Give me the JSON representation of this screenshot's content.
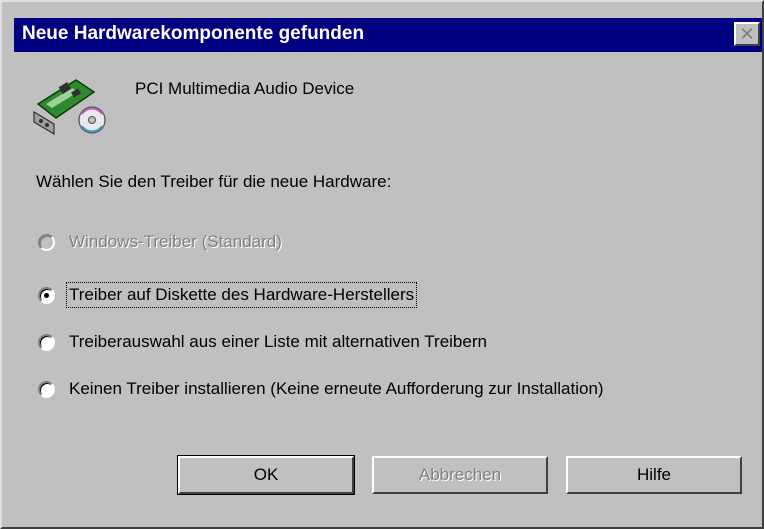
{
  "dialog": {
    "title": "Neue Hardwarekomponente gefunden",
    "close_glyph": "✕"
  },
  "device": {
    "name": "PCI Multimedia Audio Device",
    "icon": "hardware-card-icon"
  },
  "prompt": "Wählen Sie den Treiber für die neue Hardware:",
  "options": [
    {
      "label": "Windows-Treiber (Standard)",
      "checked": false,
      "disabled": true
    },
    {
      "label": "Treiber auf Diskette des Hardware-Herstellers",
      "checked": true,
      "disabled": false
    },
    {
      "label": "Treiberauswahl aus einer Liste mit alternativen Treibern",
      "checked": false,
      "disabled": false
    },
    {
      "label": "Keinen Treiber installieren (Keine erneute Aufforderung zur Installation)",
      "checked": false,
      "disabled": false
    }
  ],
  "buttons": {
    "ok": "OK",
    "cancel": "Abbrechen",
    "help": "Hilfe"
  },
  "colors": {
    "titlebar": "#000080",
    "face": "#c0c0c0",
    "disabled_text": "#808080"
  }
}
